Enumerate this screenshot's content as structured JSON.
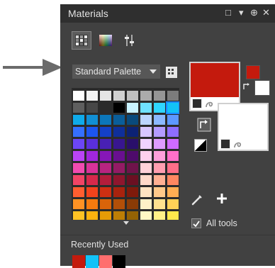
{
  "panel": {
    "title": "Materials",
    "title_controls": [
      "□",
      "▾",
      "⊕",
      "✕"
    ]
  },
  "tabs": [
    {
      "name": "palette-tab",
      "icon": "palette-grid-icon",
      "active": true
    },
    {
      "name": "rainbow-tab",
      "icon": "rainbow-spectrum-icon",
      "active": false
    },
    {
      "name": "swatches-tab",
      "icon": "swatch-sliders-icon",
      "active": false
    }
  ],
  "palette": {
    "selected": "Standard Palette",
    "swatches": [
      [
        "#ffffff",
        "#f3f3f3",
        "#e4e4e4",
        "#d1d1d1",
        "#bfbfbf",
        "#ababab",
        "#969696",
        "#7c7c7c"
      ],
      [
        "#5f5f5f",
        "#474747",
        "#2b2b2b",
        "#000000",
        "#c9f3ff",
        "#6fe1ff",
        "#2fd6ff",
        "#12c2f7"
      ],
      [
        "#0faaea",
        "#118fd4",
        "#0c77bb",
        "#0a5e9a",
        "#094a7c",
        "#bcd6ff",
        "#8cb9ff",
        "#5d98ff"
      ],
      [
        "#356fff",
        "#1c55f0",
        "#1440c8",
        "#0f2f9a",
        "#0c2275",
        "#d8c7ff",
        "#b49bff",
        "#8e6dff"
      ],
      [
        "#6c46f5",
        "#5a2fdc",
        "#4820b5",
        "#381690",
        "#2a0f6b",
        "#f0d2ff",
        "#df9cff",
        "#cf6bff"
      ],
      [
        "#ba44f5",
        "#a027dd",
        "#8616b8",
        "#690f90",
        "#4e0b6b",
        "#ffd0ee",
        "#ff9fdb",
        "#ff6fc8"
      ],
      [
        "#f24bb0",
        "#d9329a",
        "#b82480",
        "#941b65",
        "#6f134b",
        "#ffd1d8",
        "#ff9eb0",
        "#ff6e88"
      ],
      [
        "#f14465",
        "#d6294b",
        "#b31d3b",
        "#8f162e",
        "#6b1022",
        "#ffd9c9",
        "#ffb093",
        "#ff8760"
      ],
      [
        "#ff5e30",
        "#f2431c",
        "#cf2f12",
        "#a8230e",
        "#7f1a0b",
        "#ffe3c2",
        "#ffc98a",
        "#ffae53"
      ],
      [
        "#ff9224",
        "#f57a0e",
        "#d9640a",
        "#b24f08",
        "#8a3b06",
        "#fff1c7",
        "#ffe28f",
        "#ffd157"
      ],
      [
        "#ffc224",
        "#ffb30f",
        "#e69b06",
        "#bd7e05",
        "#946204",
        "#fff8c4",
        "#fff088",
        "#ffe84c"
      ]
    ]
  },
  "material": {
    "foreground": "#c41a0d",
    "background": "#ffffff"
  },
  "options": {
    "all_tools_label": "All tools",
    "all_tools_checked": true
  },
  "recently_used": {
    "label": "Recently Used",
    "colors": [
      "#c41a0d",
      "#12c2f7",
      "#ff6e6e",
      "#000000"
    ]
  },
  "annotation": {
    "arrow_color": "#6b6b6b"
  }
}
